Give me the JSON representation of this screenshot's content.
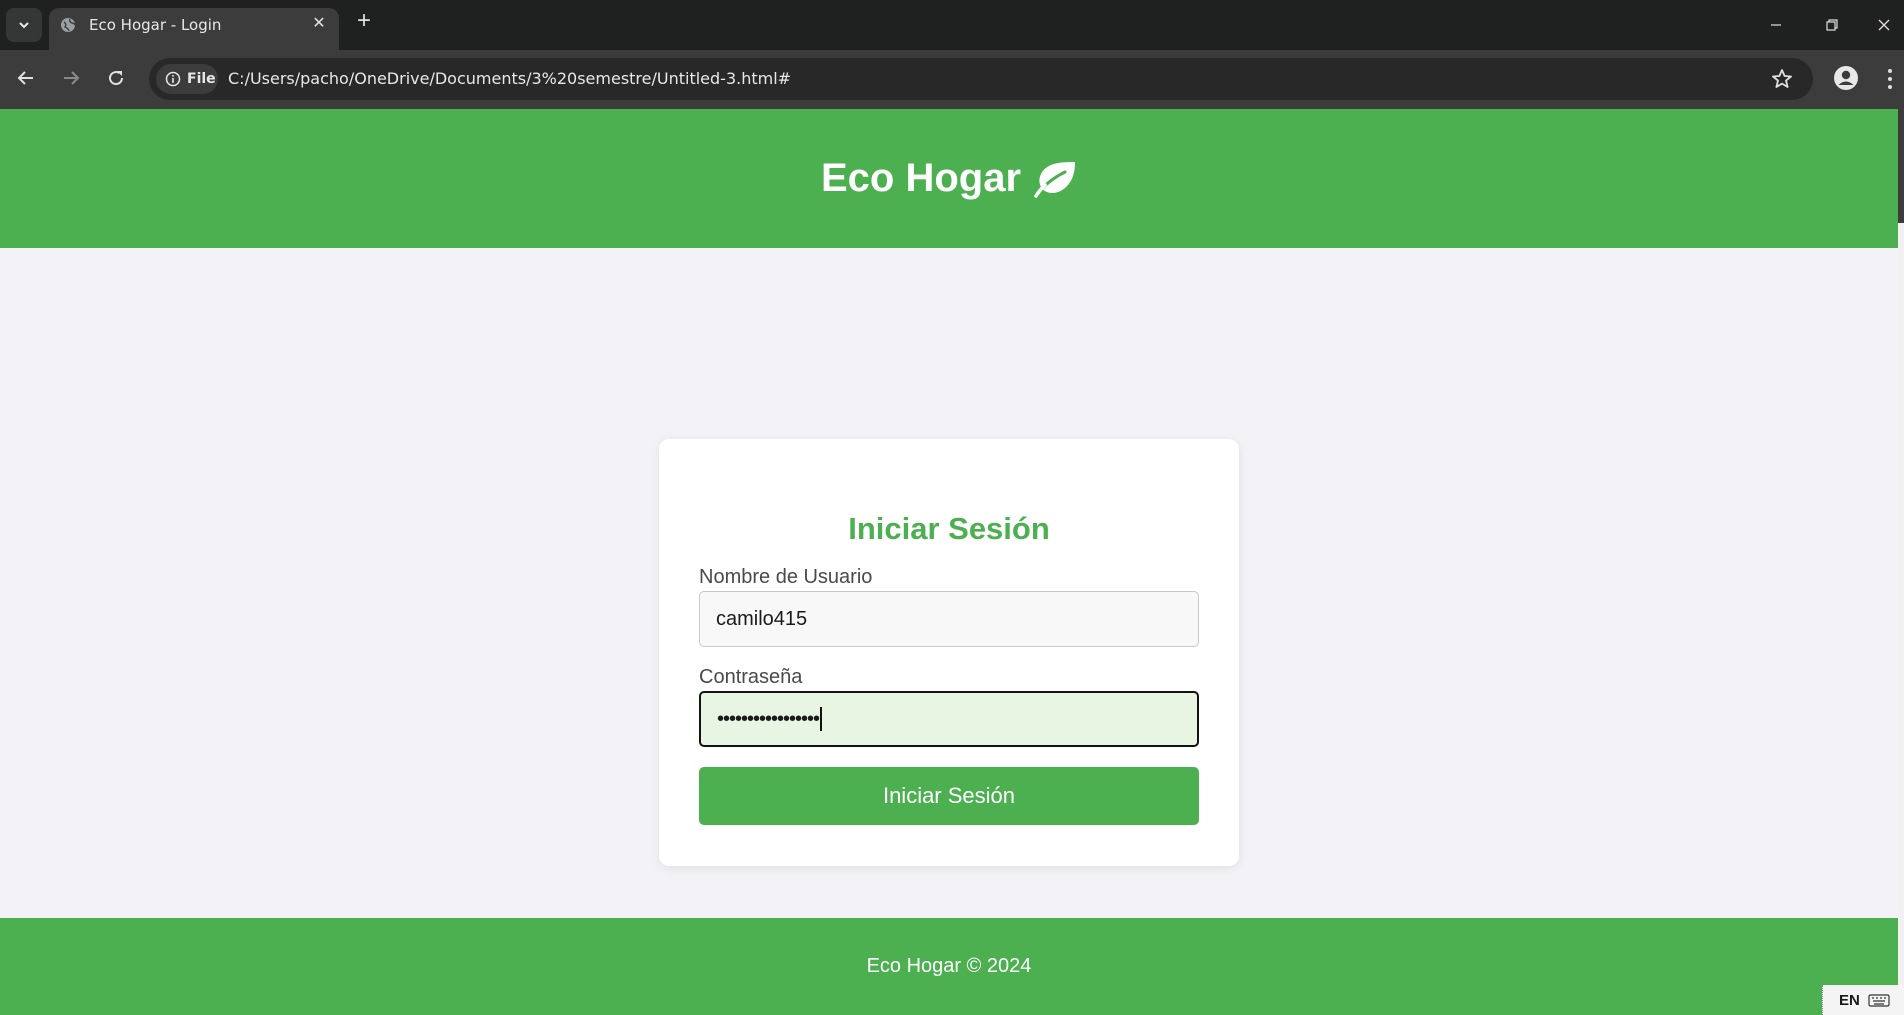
{
  "browser": {
    "tab_title": "Eco Hogar - Login",
    "file_chip": "File",
    "url": "C:/Users/pacho/OneDrive/Documents/3%20semestre/Untitled-3.html#"
  },
  "header": {
    "title": "Eco Hogar",
    "icon": "leaf-icon"
  },
  "login": {
    "title": "Iniciar Sesión",
    "username_label": "Nombre de Usuario",
    "username_value": "camilo415",
    "password_label": "Contraseña",
    "password_masked": "•••••••••••••••••",
    "submit_label": "Iniciar Sesión"
  },
  "footer": {
    "text": "Eco Hogar © 2024"
  },
  "tray": {
    "language": "EN"
  },
  "colors": {
    "brand_green": "#4caf50",
    "page_bg": "#f3f3f7",
    "focused_input_bg": "#e8f5e3"
  }
}
